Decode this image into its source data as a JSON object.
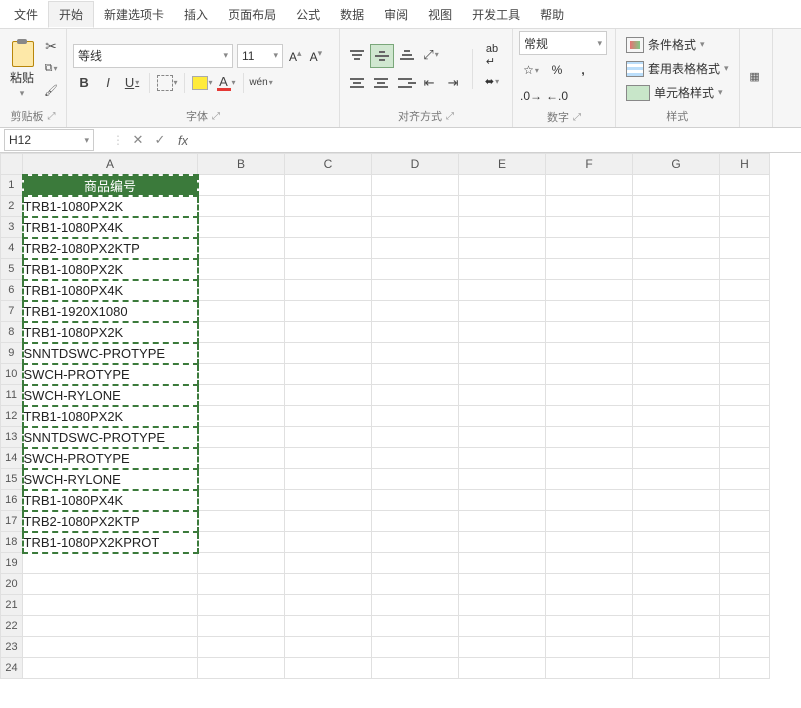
{
  "menu": {
    "file": "文件",
    "home": "开始",
    "newtab": "新建选项卡",
    "insert": "插入",
    "layout": "页面布局",
    "formula": "公式",
    "data": "数据",
    "review": "审阅",
    "view": "视图",
    "dev": "开发工具",
    "help": "帮助"
  },
  "clipboard": {
    "paste": "粘贴",
    "label": "剪贴板"
  },
  "font": {
    "name": "等线",
    "size": "11",
    "wen": "wén",
    "label": "字体"
  },
  "align": {
    "label": "对齐方式"
  },
  "number": {
    "format": "常规",
    "pct": "%",
    "comma": ",",
    "label": "数字"
  },
  "styles": {
    "cf": "条件格式",
    "tblfmt": "套用表格格式",
    "cellstyle": "单元格样式",
    "label": "样式"
  },
  "namebox": "H12",
  "cols": [
    "A",
    "B",
    "C",
    "D",
    "E",
    "F",
    "G",
    "H"
  ],
  "header": "商品编号",
  "rows": [
    "TRB1-1080PX2K",
    "TRB1-1080PX4K",
    "TRB2-1080PX2KTP",
    "TRB1-1080PX2K",
    "TRB1-1080PX4K",
    "TRB1-1920X1080",
    "TRB1-1080PX2K",
    "SNNTDSWC-PROTYPE",
    "SWCH-PROTYPE",
    "SWCH-RYLONE",
    "TRB1-1080PX2K",
    "SNNTDSWC-PROTYPE",
    "SWCH-PROTYPE",
    "SWCH-RYLONE",
    "TRB1-1080PX4K",
    "TRB2-1080PX2KTP",
    "TRB1-1080PX2KPROT"
  ],
  "emptyRows": 6
}
